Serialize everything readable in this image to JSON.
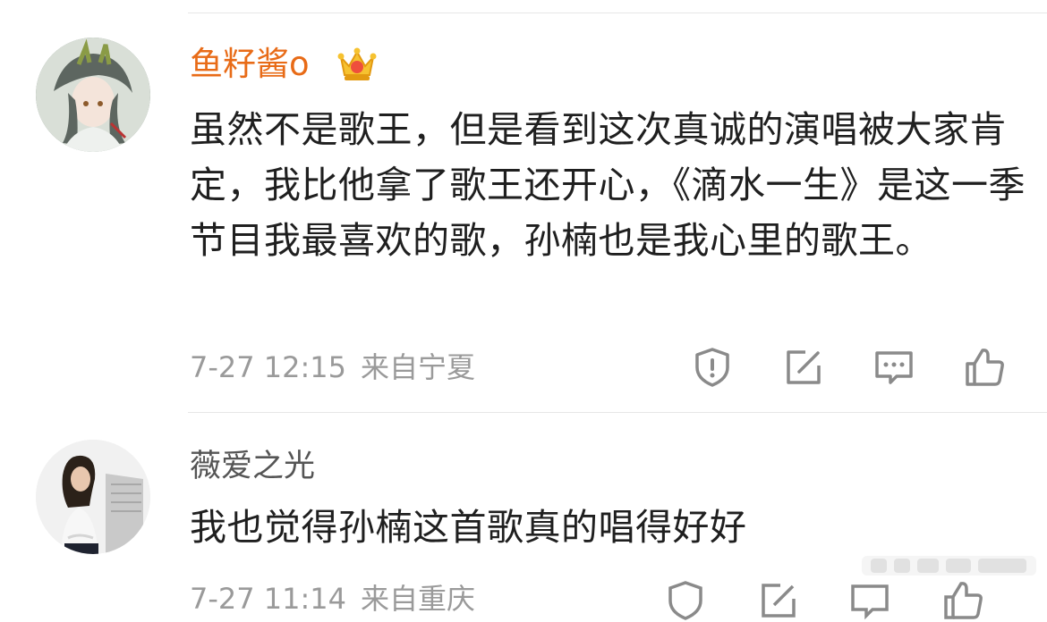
{
  "comments": [
    {
      "username": "鱼籽酱o",
      "text": "虽然不是歌王，但是看到这次真诚的演唱被大家肯定，我比他拿了歌王还开心，《滴水一生》是这一季节目我最喜欢的歌，孙楠也是我心里的歌王。",
      "time": "7-27 12:15",
      "location": "来自宁夏",
      "badge": "crown-vip-icon"
    },
    {
      "username": "薇爱之光",
      "text": "我也觉得孙楠这首歌真的唱得好好",
      "time": "7-27 11:14",
      "location": "来自重庆"
    }
  ],
  "actions": [
    "report-icon",
    "repost-icon",
    "comment-icon",
    "like-icon"
  ],
  "colors": {
    "username_vip": "#e86b17",
    "username": "#555555",
    "text": "#1f1f1f",
    "meta": "#9a9a9a",
    "icon": "#8a8a8a"
  }
}
